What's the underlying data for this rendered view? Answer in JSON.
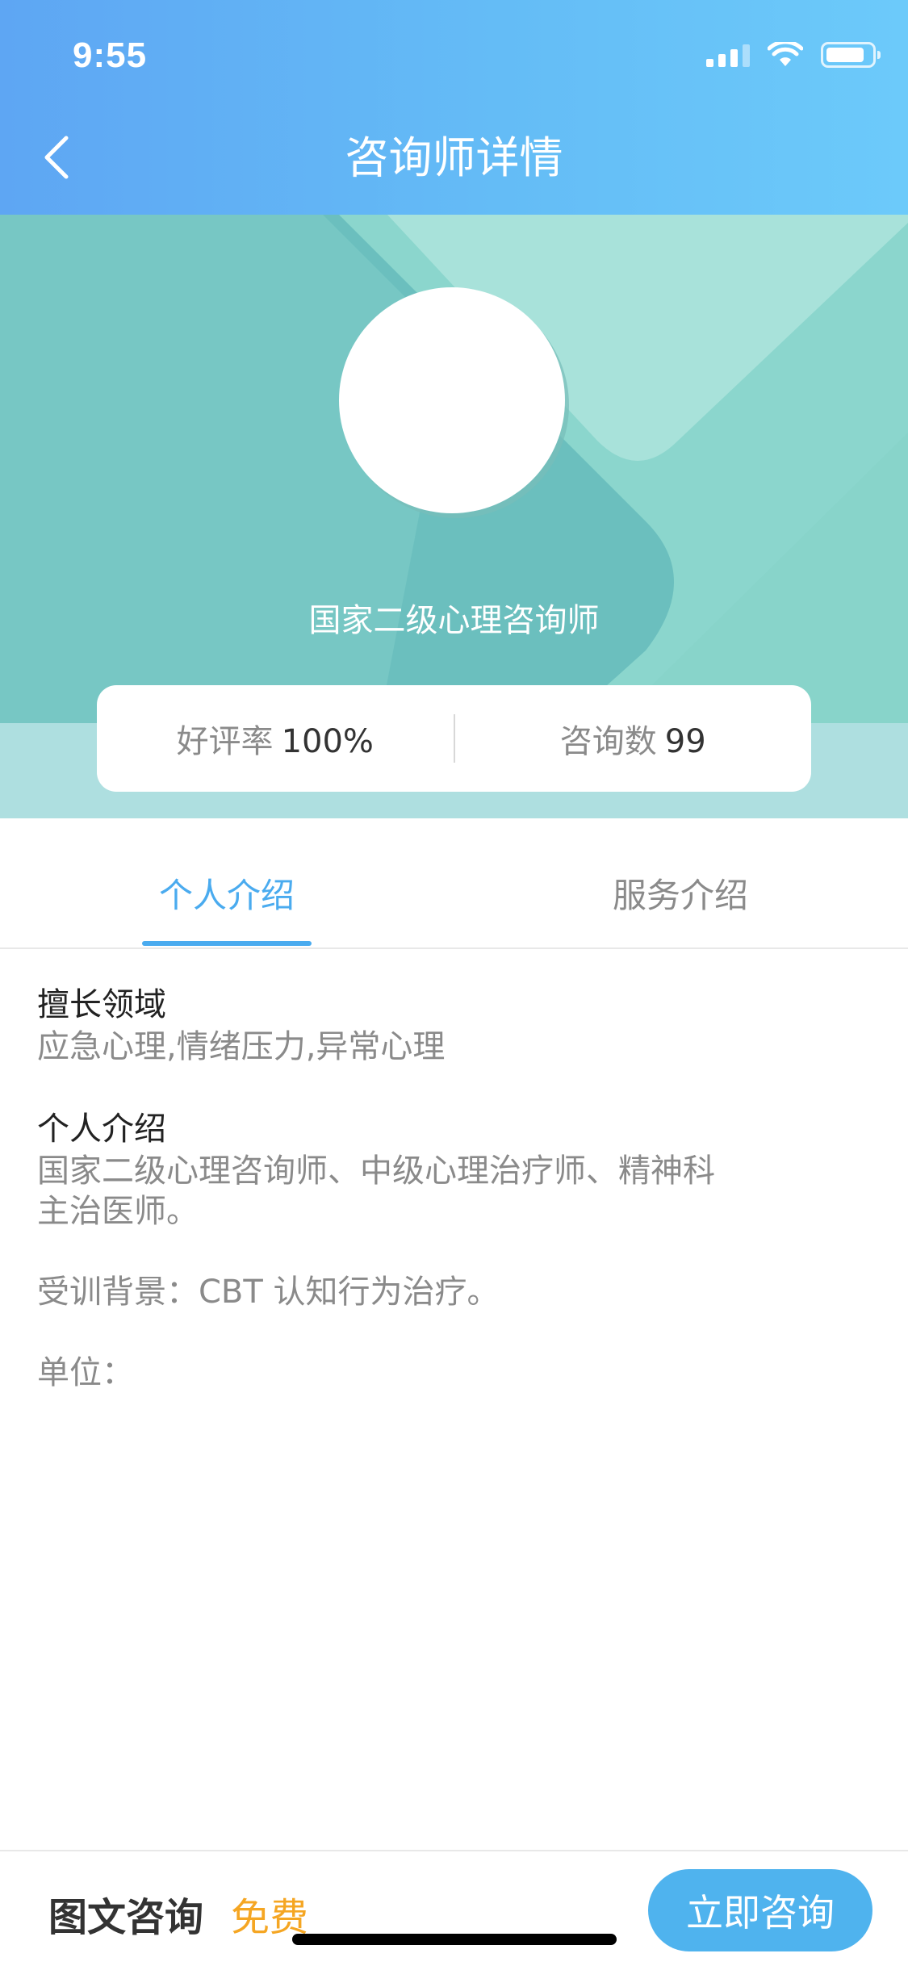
{
  "status_bar": {
    "time": "9:55"
  },
  "header": {
    "title": "咨询师详情"
  },
  "counselor": {
    "title": "国家二级心理咨询师",
    "stats": {
      "rating_label": "好评率",
      "rating_value": "100%",
      "consult_label": "咨询数",
      "consult_value": "99"
    }
  },
  "tabs": [
    {
      "label": "个人介绍",
      "active": true
    },
    {
      "label": "服务介绍",
      "active": false
    }
  ],
  "profile": {
    "specialty_title": "擅长领域",
    "specialty_text": "应急心理,情绪压力,异常心理",
    "intro_title": "个人介绍",
    "intro_line1": "国家二级心理咨询师、中级心理治疗师、精神科",
    "intro_line2": "主治医师。",
    "training": "受训背景：CBT 认知行为治疗。",
    "unit": "单位："
  },
  "bottom": {
    "service_label": "图文咨询",
    "price": "免费",
    "button_label": "立即咨询"
  },
  "colors": {
    "header_start": "#5ea6f3",
    "header_end": "#6ccafa",
    "accent": "#4aabef",
    "price": "#f5a623",
    "hero_teal": "#7ccfc6"
  }
}
